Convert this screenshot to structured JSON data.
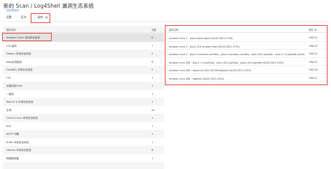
{
  "page": {
    "title": "新的 Scan / Log4Shell 漏洞生态系统",
    "back_link": "返回到报告"
  },
  "tabs": [
    {
      "label": "设置",
      "count": ""
    },
    {
      "label": "证书",
      "count": ""
    },
    {
      "label": "插件",
      "count": "48"
    }
  ],
  "left_table": {
    "columns": [
      "插件系列",
      "总数"
    ],
    "rows": [
      {
        "name": "Amazon Linux 本地安全检查",
        "count": "6"
      },
      {
        "name": "CGI 滥用",
        "count": "7"
      },
      {
        "name": "Debian 本地安全检查",
        "count": "5"
      },
      {
        "name": "Web应用程序",
        "count": "6"
      },
      {
        "name": "FreeBSD 本地安全检查",
        "count": "5"
      },
      {
        "name": "FTP",
        "count": "1"
      },
      {
        "name": "远程控制Shell",
        "count": "1"
      },
      {
        "name": "一般的",
        "count": "1"
      },
      {
        "name": "MacOS X 本地安全检查",
        "count": "1"
      },
      {
        "name": "杂项",
        "count": "24"
      },
      {
        "name": "Oracle Linux 本地安全检查",
        "count": "1"
      },
      {
        "name": "RPC",
        "count": "1"
      },
      {
        "name": "SMTP 问题",
        "count": "1"
      },
      {
        "name": "SUSE 本地安全检查",
        "count": "1"
      },
      {
        "name": "Ubuntu 本地安全检查",
        "count": "8"
      },
      {
        "name": "网络服务器",
        "count": "1"
      }
    ]
  },
  "right_table": {
    "columns": [
      "插件名称",
      "插件 ID"
    ],
    "rows": [
      {
        "name": "Amazon Linux 2：java-kinesis-agent (ALAS-2021-1730)",
        "id": "156112"
      },
      {
        "name": "Amazon Linux 2：java-1.8.0-amazon-fixed (ALAS-2021-1731)",
        "id": "156113"
      },
      {
        "name": "Amazon Linux 2：java-17-amazon-corretto、java-11-amazon-corretto、java-1.8.0-openjdk、java-1.7.0-openjdk (ALAS-2021-1732)",
        "id": "156114"
      },
      {
        "name": "Amazon Linux AMI：java-1.7.0-openjdk、java-1.8.0-openjdk、java-1.6.0-openjdk (ALAS-2021-1553)",
        "id": "156115"
      },
      {
        "name": "Amazon Linux AMI：log4j-cve-2021-44228-hotpatch (ALAS-2021-1553)",
        "id": "156116"
      },
      {
        "name": "Amazon Linux AMI：logstash (ALAS-2021-1554)",
        "id": "156117"
      }
    ]
  }
}
